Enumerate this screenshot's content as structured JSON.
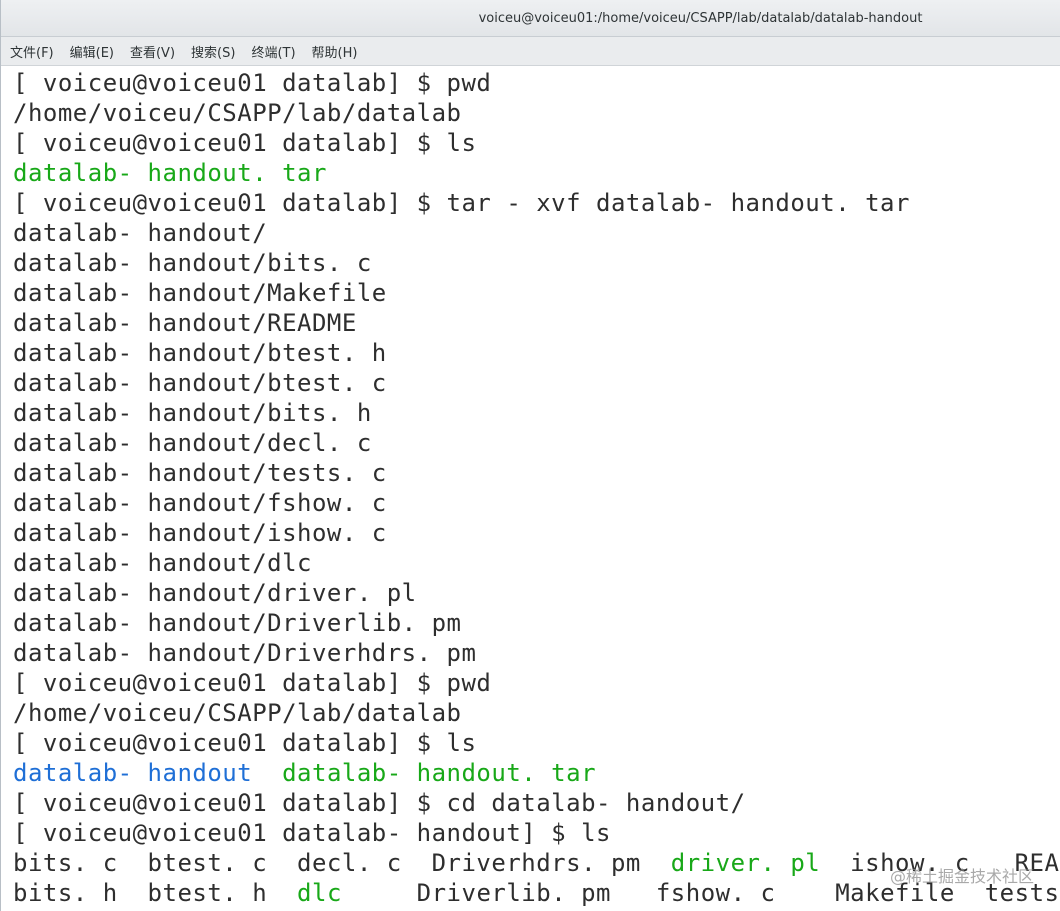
{
  "window": {
    "title": "voiceu@voiceu01:/home/voiceu/CSAPP/lab/datalab/datalab-handout"
  },
  "menubar": {
    "items": [
      "文件(F)",
      "编辑(E)",
      "查看(V)",
      "搜索(S)",
      "终端(T)",
      "帮助(H)"
    ]
  },
  "colors": {
    "text": "#2e2e2e",
    "executable_green": "#18a818",
    "directory_blue": "#1f6fd6",
    "background": "#ffffff"
  },
  "terminal": {
    "lines": [
      [
        {
          "t": "[ voiceu@voiceu01 datalab] $ pwd"
        }
      ],
      [
        {
          "t": "/home/voiceu/CSAPP/lab/datalab"
        }
      ],
      [
        {
          "t": "[ voiceu@voiceu01 datalab] $ ls"
        }
      ],
      [
        {
          "t": "datalab- handout. tar",
          "c": "green"
        }
      ],
      [
        {
          "t": "[ voiceu@voiceu01 datalab] $ tar - xvf datalab- handout. tar"
        }
      ],
      [
        {
          "t": "datalab- handout/"
        }
      ],
      [
        {
          "t": "datalab- handout/bits. c"
        }
      ],
      [
        {
          "t": "datalab- handout/Makefile"
        }
      ],
      [
        {
          "t": "datalab- handout/README"
        }
      ],
      [
        {
          "t": "datalab- handout/btest. h"
        }
      ],
      [
        {
          "t": "datalab- handout/btest. c"
        }
      ],
      [
        {
          "t": "datalab- handout/bits. h"
        }
      ],
      [
        {
          "t": "datalab- handout/decl. c"
        }
      ],
      [
        {
          "t": "datalab- handout/tests. c"
        }
      ],
      [
        {
          "t": "datalab- handout/fshow. c"
        }
      ],
      [
        {
          "t": "datalab- handout/ishow. c"
        }
      ],
      [
        {
          "t": "datalab- handout/dlc"
        }
      ],
      [
        {
          "t": "datalab- handout/driver. pl"
        }
      ],
      [
        {
          "t": "datalab- handout/Driverlib. pm"
        }
      ],
      [
        {
          "t": "datalab- handout/Driverhdrs. pm"
        }
      ],
      [
        {
          "t": "[ voiceu@voiceu01 datalab] $ pwd"
        }
      ],
      [
        {
          "t": "/home/voiceu/CSAPP/lab/datalab"
        }
      ],
      [
        {
          "t": "[ voiceu@voiceu01 datalab] $ ls"
        }
      ],
      [
        {
          "t": "datalab- handout",
          "c": "blue"
        },
        {
          "t": "  "
        },
        {
          "t": "datalab- handout. tar",
          "c": "green"
        }
      ],
      [
        {
          "t": "[ voiceu@voiceu01 datalab] $ cd datalab- handout/"
        }
      ],
      [
        {
          "t": "[ voiceu@voiceu01 datalab- handout] $ ls"
        }
      ],
      [
        {
          "t": "bits. c  btest. c  decl. c  Driverhdrs. pm  "
        },
        {
          "t": "driver. pl",
          "c": "green"
        },
        {
          "t": "  ishow. c   README"
        }
      ],
      [
        {
          "t": "bits. h  btest. h  "
        },
        {
          "t": "dlc",
          "c": "green"
        },
        {
          "t": "     Driverlib. pm   fshow. c    Makefile  tests. c"
        }
      ]
    ]
  },
  "watermark": "@稀土掘金技术社区"
}
